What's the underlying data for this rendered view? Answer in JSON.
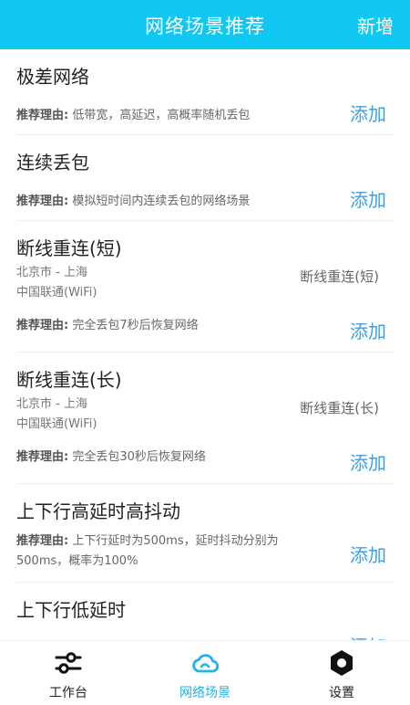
{
  "header": {
    "title": "网络场景推荐",
    "new_label": "新增"
  },
  "reason_prefix": "推荐理由:",
  "add_label": "添加",
  "items": [
    {
      "title": "极差网络",
      "reason": "低带宽，高延迟，高概率随机丢包"
    },
    {
      "title": "连续丢包",
      "reason": "模拟短时间内连续丢包的网络场景"
    },
    {
      "title": "断线重连(短)",
      "location": "北京市 - 上海",
      "carrier": "中国联通(WiFi)",
      "side": "断线重连(短)",
      "reason": "完全丢包7秒后恢复网络"
    },
    {
      "title": "断线重连(长)",
      "location": "北京市 - 上海",
      "carrier": "中国联通(WiFi)",
      "side": "断线重连(长)",
      "reason": "完全丢包30秒后恢复网络"
    },
    {
      "title": "上下行高延时高抖动",
      "reason": "上下行延时为500ms，延时抖动分别为500ms，概率为100%"
    },
    {
      "title": "上下行低延时"
    }
  ],
  "tabs": [
    {
      "label": "工作台",
      "icon": "sliders-icon",
      "active": false
    },
    {
      "label": "网络场景",
      "icon": "cloud-icon",
      "active": true
    },
    {
      "label": "设置",
      "icon": "hex-gear-icon",
      "active": false
    }
  ],
  "colors": {
    "accent": "#10c8f2",
    "link": "#3aa0ea",
    "active_tab": "#1fb4ea"
  }
}
